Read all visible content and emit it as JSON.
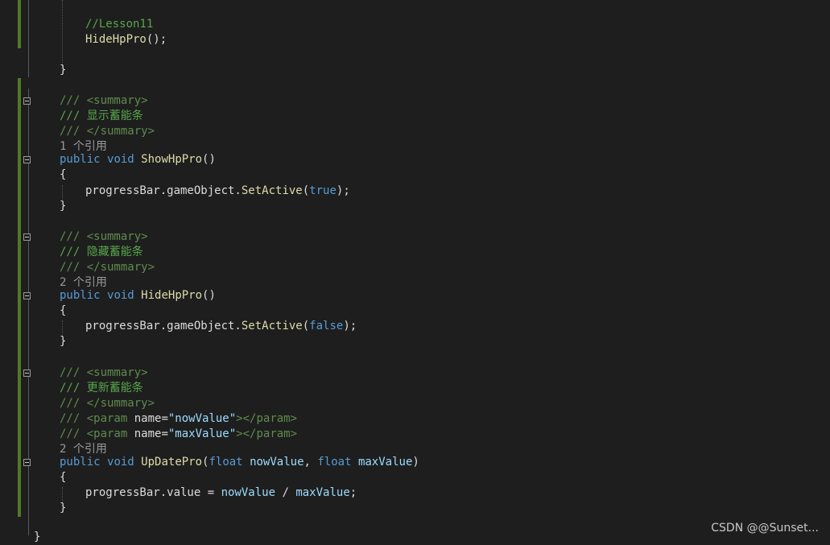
{
  "code": {
    "lesson_comment": "//Lesson11",
    "hide_call": "HideHpPro",
    "call_suffix": "();",
    "close_brace": "}",
    "open_brace": "{",
    "summary_open": "/// <summary>",
    "summary_close": "/// </summary>",
    "show_summary_text": "/// 显示蓄能条",
    "hide_summary_text": "/// 隐藏蓄能条",
    "update_summary_text": "/// 更新蓄能条",
    "show_refs": "1 个引用",
    "hide_refs": "2 个引用",
    "update_refs": "2 个引用",
    "kw_public": "public",
    "kw_void": "void",
    "kw_float": "float",
    "show_name": "ShowHpPro",
    "hide_name": "HideHpPro",
    "update_name": "UpDatePro",
    "parens": "()",
    "open_paren": "(",
    "close_paren": ")",
    "comma": ", ",
    "progress_prefix": "progressBar.gameObject.",
    "set_active": "SetActive",
    "kw_true": "true",
    "kw_false": "false",
    "param_comment_prefix": "/// ",
    "param_tag_open": "<param",
    "param_attr": " name=",
    "param_tag_mid": "></param>",
    "param_now_quoted": "\"nowValue\"",
    "param_max_quoted": "\"maxValue\"",
    "now_value": "nowValue",
    "max_value": "maxValue",
    "progress_value": "progressBar.value = ",
    "divide": " / ",
    "semicolon": ";",
    "end_paren_semicolon": ");",
    "class_close": "}"
  },
  "watermark": "CSDN @@Sunset..."
}
